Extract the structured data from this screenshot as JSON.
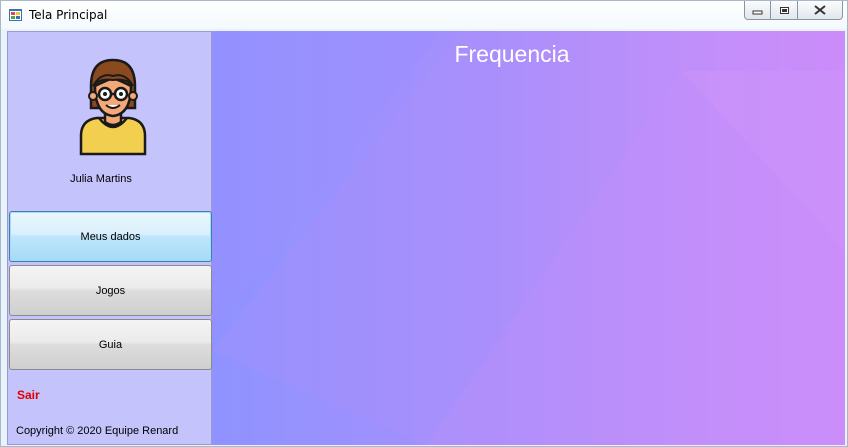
{
  "window": {
    "title": "Tela Principal"
  },
  "sidebar": {
    "user_name": "Julia Martins",
    "buttons": [
      {
        "label": "Meus dados"
      },
      {
        "label": "Jogos"
      },
      {
        "label": "Guia"
      }
    ],
    "exit_label": "Sair",
    "copyright": "Copyright © 2020 Equipe Renard"
  },
  "main": {
    "title": "Frequencia"
  },
  "colors": {
    "sidebar_bg": "#c5c3fc",
    "exit_text": "#e00000",
    "gradient_start": "#8f93ff",
    "gradient_end": "#d18cfb"
  }
}
